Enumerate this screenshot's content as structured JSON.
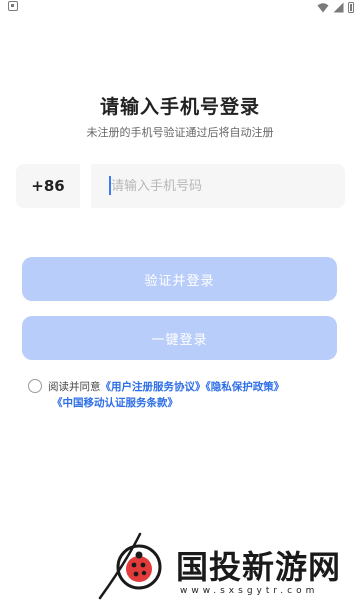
{
  "status_bar": {
    "icons": [
      "notification-icon",
      "wifi-icon",
      "signal-icon",
      "battery-icon"
    ]
  },
  "header": {
    "title": "请输入手机号登录",
    "subtitle": "未注册的手机号验证通过后将自动注册"
  },
  "phone": {
    "country_code": "+86",
    "placeholder": "请输入手机号码",
    "value": ""
  },
  "buttons": {
    "verify_login": "验证并登录",
    "one_click_login": "一键登录"
  },
  "agreement": {
    "checked": false,
    "prefix": "阅读并同意",
    "user_agreement": "《用户注册服务协议》",
    "privacy_policy": "《隐私保护政策》",
    "cmcc_terms": "《中国移动认证服务条款》"
  },
  "watermark": {
    "name": "国投新游网",
    "url": "www.sxsgytr.com"
  },
  "colors": {
    "accent": "#2f6fe8",
    "button_disabled": "#b9cdfb",
    "input_bg": "#f6f6f6"
  }
}
